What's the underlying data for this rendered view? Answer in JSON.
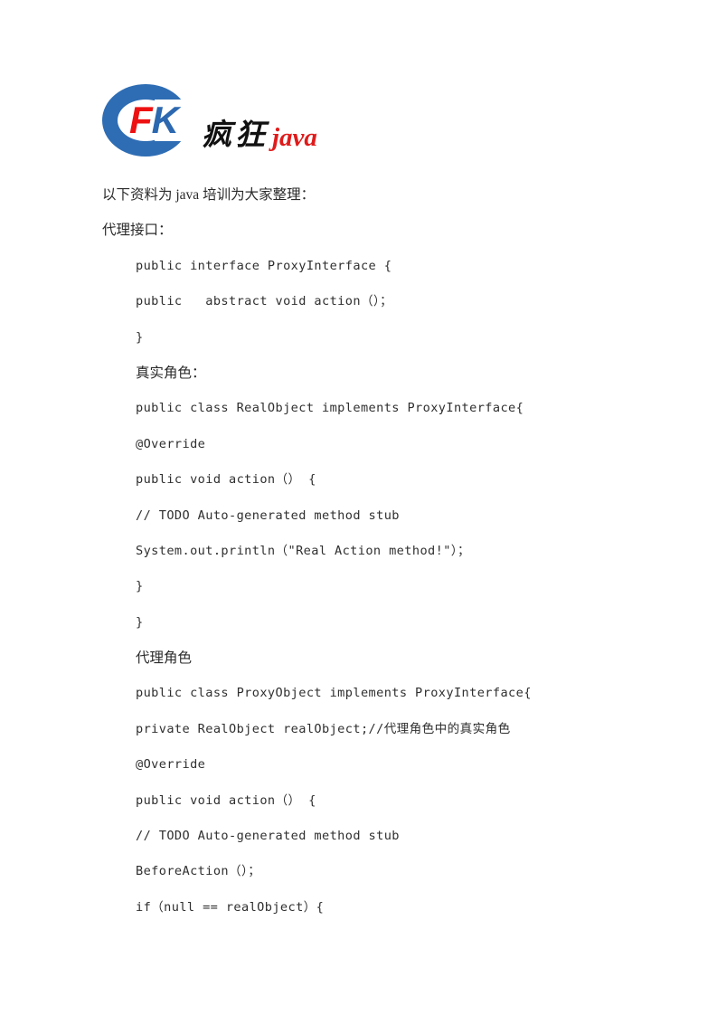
{
  "logo": {
    "letter_f": "F",
    "letter_k": "K",
    "chinese": "疯狂",
    "java": "java",
    "colors": {
      "ring_blue": "#2e6db4",
      "letter_f_red": "#ee1111",
      "letter_k_blue": "#2c68b0",
      "java_red": "#e01b1b",
      "chinese_black": "#111111"
    }
  },
  "document": {
    "lines": [
      {
        "kind": "prose",
        "text": "以下资料为 java 培训为大家整理："
      },
      {
        "kind": "prose",
        "text": "代理接口："
      },
      {
        "kind": "code",
        "text": "public interface ProxyInterface {"
      },
      {
        "kind": "code",
        "text": "public   abstract void action（）；"
      },
      {
        "kind": "code",
        "text": "}"
      },
      {
        "kind": "cnhead",
        "text": "真实角色："
      },
      {
        "kind": "code",
        "text": "public class RealObject implements ProxyInterface{"
      },
      {
        "kind": "code",
        "text": "@Override"
      },
      {
        "kind": "code",
        "text": "public void action（） {"
      },
      {
        "kind": "code",
        "text": "// TODO Auto-generated method stub"
      },
      {
        "kind": "code",
        "text": "System.out.println（\"Real Action method!\"）；"
      },
      {
        "kind": "code",
        "text": "}"
      },
      {
        "kind": "code",
        "text": "}"
      },
      {
        "kind": "cnhead",
        "text": "代理角色"
      },
      {
        "kind": "code",
        "text": "public class ProxyObject implements ProxyInterface{"
      },
      {
        "kind": "code",
        "text": "private RealObject realObject;//代理角色中的真实角色"
      },
      {
        "kind": "code",
        "text": "@Override"
      },
      {
        "kind": "code",
        "text": "public void action（） {"
      },
      {
        "kind": "code",
        "text": "// TODO Auto-generated method stub"
      },
      {
        "kind": "code",
        "text": "BeforeAction（）；"
      },
      {
        "kind": "code",
        "text": "if（null == realObject）{"
      }
    ]
  }
}
